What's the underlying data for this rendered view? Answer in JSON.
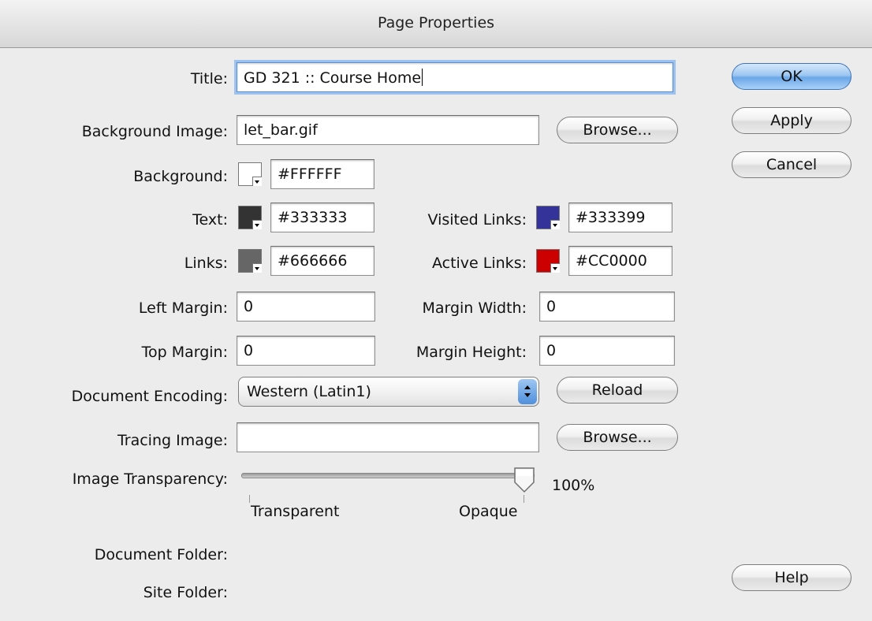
{
  "window": {
    "title": "Page Properties"
  },
  "fields": {
    "title": {
      "label": "Title:",
      "value": "GD 321 :: Course Home"
    },
    "background_image": {
      "label": "Background Image:",
      "value": "let_bar.gif",
      "browse": "Browse..."
    },
    "background": {
      "label": "Background:",
      "value": "#FFFFFF",
      "color": "#FFFFFF"
    },
    "text": {
      "label": "Text:",
      "value": "#333333",
      "color": "#333333"
    },
    "visited_links": {
      "label": "Visited Links:",
      "value": "#333399",
      "color": "#333399"
    },
    "links": {
      "label": "Links:",
      "value": "#666666",
      "color": "#666666"
    },
    "active_links": {
      "label": "Active Links:",
      "value": "#CC0000",
      "color": "#CC0000"
    },
    "left_margin": {
      "label": "Left Margin:",
      "value": "0"
    },
    "margin_width": {
      "label": "Margin Width:",
      "value": "0"
    },
    "top_margin": {
      "label": "Top Margin:",
      "value": "0"
    },
    "margin_height": {
      "label": "Margin Height:",
      "value": "0"
    },
    "document_encoding": {
      "label": "Document Encoding:",
      "value": "Western (Latin1)",
      "reload": "Reload"
    },
    "tracing_image": {
      "label": "Tracing Image:",
      "value": "",
      "browse": "Browse..."
    },
    "image_transparency": {
      "label": "Image Transparency:",
      "percent": "100%",
      "level": 1.0,
      "min_label": "Transparent",
      "max_label": "Opaque"
    },
    "document_folder": {
      "label": "Document Folder:",
      "value": ""
    },
    "site_folder": {
      "label": "Site Folder:",
      "value": ""
    }
  },
  "buttons": {
    "ok": "OK",
    "apply": "Apply",
    "cancel": "Cancel",
    "help": "Help"
  },
  "colors": {
    "default_button": "#6ba7e8",
    "focus_ring": "#9ec2ee"
  }
}
